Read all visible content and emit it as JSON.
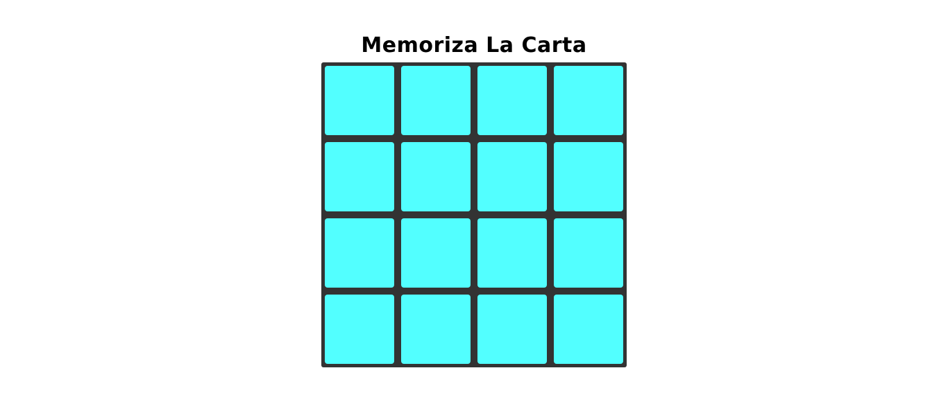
{
  "title": "Memoriza La Carta",
  "board": {
    "rows": 4,
    "cols": 4,
    "board_color": "#333333",
    "card_back_color": "#52ffff",
    "cards": [
      {
        "state": "face-down"
      },
      {
        "state": "face-down"
      },
      {
        "state": "face-down"
      },
      {
        "state": "face-down"
      },
      {
        "state": "face-down"
      },
      {
        "state": "face-down"
      },
      {
        "state": "face-down"
      },
      {
        "state": "face-down"
      },
      {
        "state": "face-down"
      },
      {
        "state": "face-down"
      },
      {
        "state": "face-down"
      },
      {
        "state": "face-down"
      },
      {
        "state": "face-down"
      },
      {
        "state": "face-down"
      },
      {
        "state": "face-down"
      },
      {
        "state": "face-down"
      }
    ]
  }
}
